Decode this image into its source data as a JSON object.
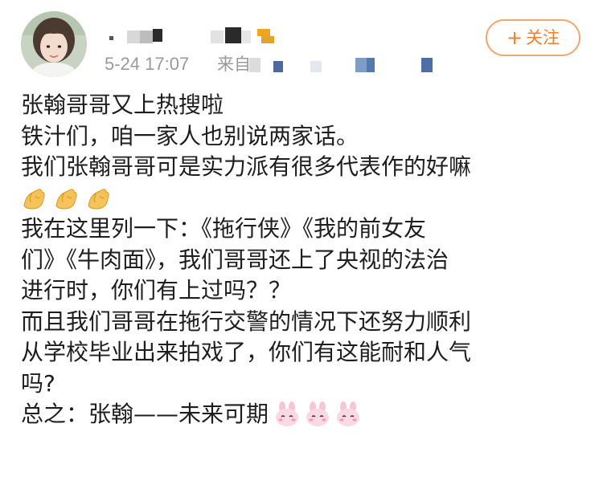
{
  "header": {
    "author_name": "",
    "time": "5-24 17:07",
    "source_prefix": "来自",
    "follow_plus": "+",
    "follow_label": "关注",
    "accent_color": "#f07f2a"
  },
  "post": {
    "lines": [
      "张翰哥哥又上热搜啦",
      "铁汁们，咱一家人也别说两家话。",
      "我们张翰哥哥可是实力派有很多代表作的好嘛"
    ],
    "emoji_row_1": [
      "ok-hand-emoji",
      "ok-hand-emoji",
      "ok-hand-emoji"
    ],
    "lines_2": [
      "我在这里列一下：《拖行侠》《我的前女友",
      "们》《牛肉面》，我们哥哥还上了央视的法治",
      "进行时，你们有上过吗？？",
      "而且我们哥哥在拖行交警的情况下还努力顺利",
      "从学校毕业出来拍戏了，你们有这能耐和人气",
      "吗?"
    ],
    "closing": "总之：张翰——未来可期",
    "emoji_row_2": [
      "pink-bunny-emoji",
      "pink-bunny-emoji",
      "pink-bunny-emoji"
    ]
  }
}
